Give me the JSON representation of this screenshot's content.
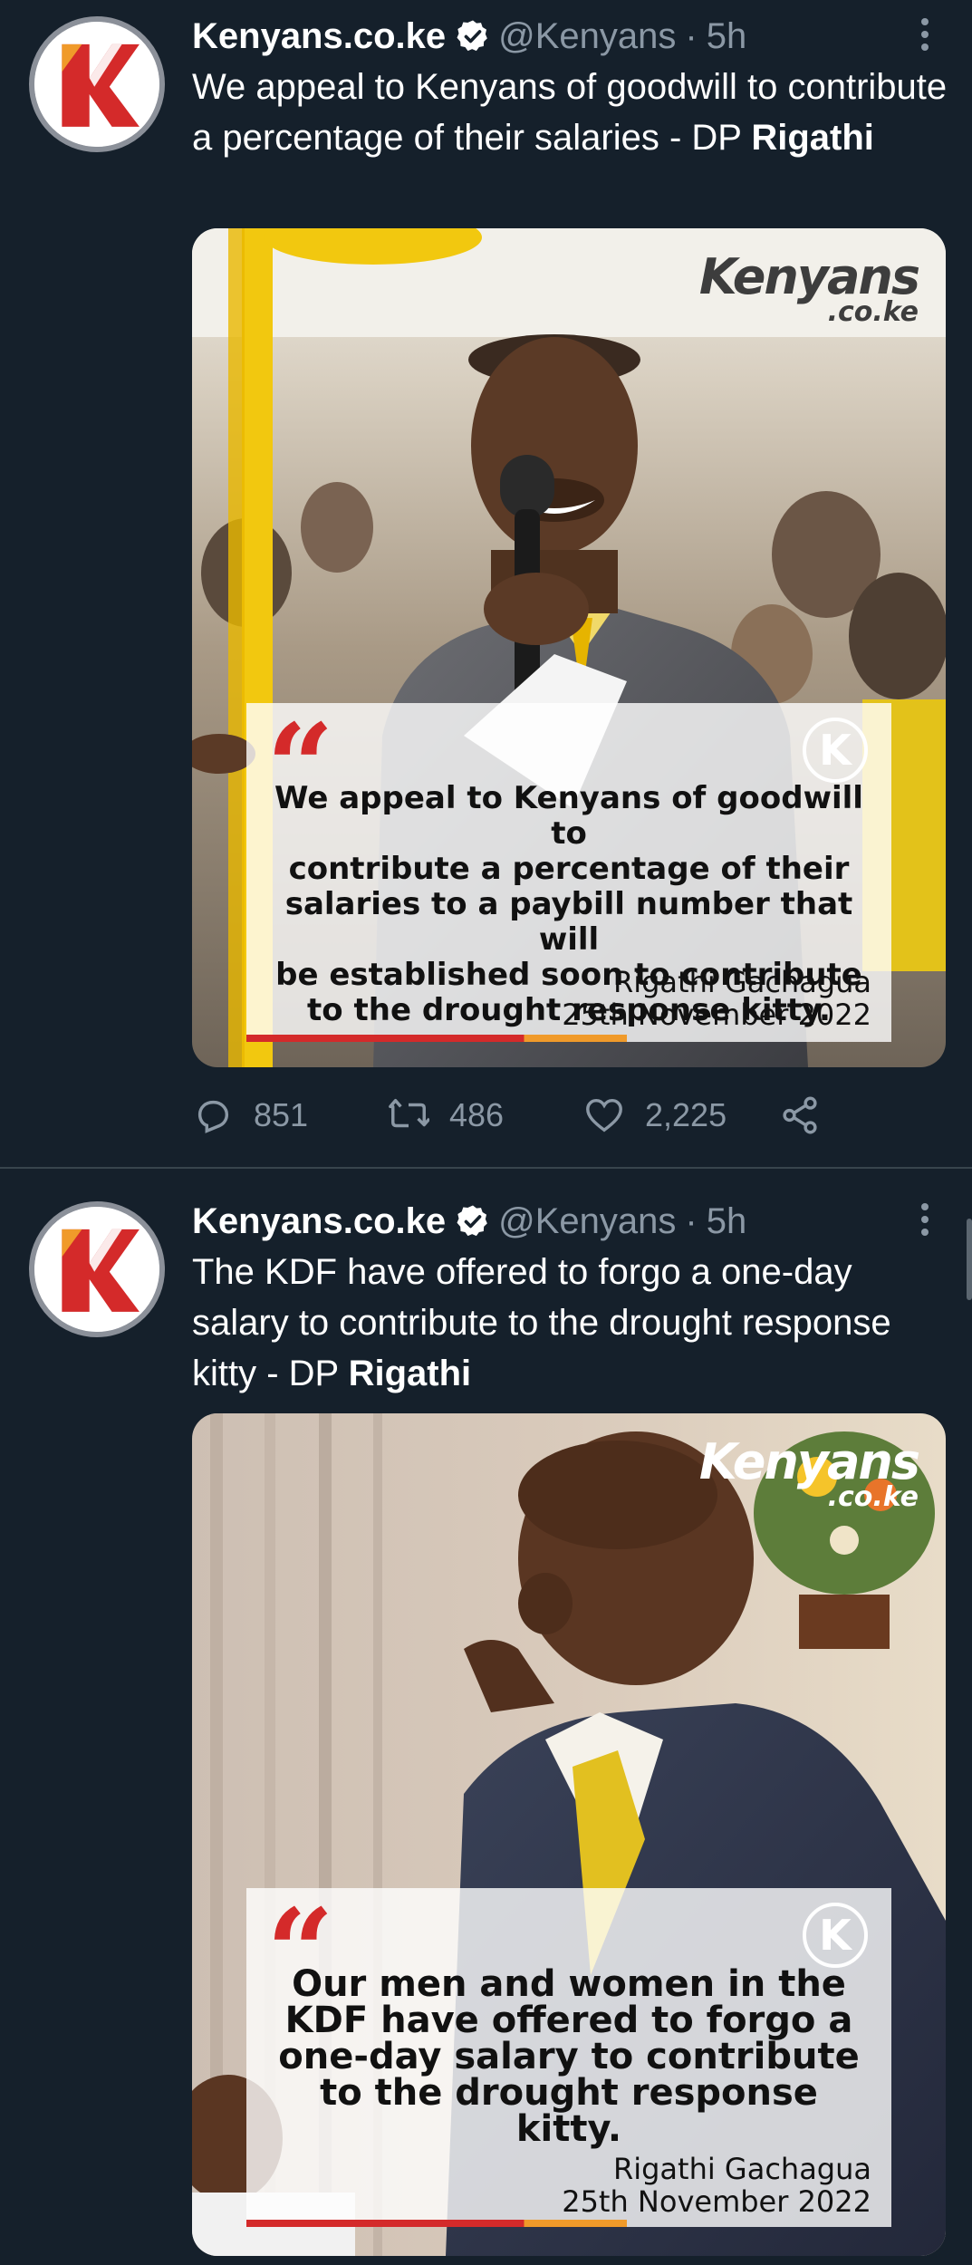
{
  "colors": {
    "background": "#15202b",
    "text_primary": "#ffffff",
    "text_secondary": "#8b98a5",
    "verified": "#ffffff",
    "brand_red": "#d42a2a",
    "brand_orange": "#f09a2a"
  },
  "tweets": [
    {
      "author": {
        "display_name": "Kenyans.co.ke",
        "handle": "@Kenyans",
        "time": "5h",
        "verified_icon": "verified-badge-icon",
        "avatar_icon": "kenyans-k-logo"
      },
      "text_plain": "We appeal to Kenyans of goodwill to contribute a percentage of their salaries - DP ",
      "text_bold": "Rigathi",
      "media": {
        "watermark_main": "Kenyans",
        "watermark_sub": ".co.ke",
        "quote_lines": [
          "We appeal to Kenyans of goodwill to",
          "contribute a percentage of their",
          "salaries to a paybill number that will",
          "be established soon to contribute",
          "to the drought response kitty."
        ],
        "quote_author": "Rigathi Gachagua",
        "quote_date": "25th November 2022",
        "badge_letter": "K"
      },
      "actions": {
        "reply_count": "851",
        "retweet_count": "486",
        "like_count": "2,225"
      }
    },
    {
      "author": {
        "display_name": "Kenyans.co.ke",
        "handle": "@Kenyans",
        "time": "5h",
        "verified_icon": "verified-badge-icon",
        "avatar_icon": "kenyans-k-logo"
      },
      "text_plain": "The KDF have offered to forgo a one-day salary to contribute to the drought response kitty - DP ",
      "text_bold": "Rigathi",
      "media": {
        "watermark_main": "Kenyans",
        "watermark_sub": ".co.ke",
        "quote_lines": [
          "Our men and women in the",
          "KDF have offered to forgo a",
          "one-day salary to contribute",
          "to the drought response",
          "kitty."
        ],
        "quote_author": "Rigathi Gachagua",
        "quote_date": "25th November 2022",
        "badge_letter": "K"
      }
    }
  ],
  "separator_dot": "·"
}
